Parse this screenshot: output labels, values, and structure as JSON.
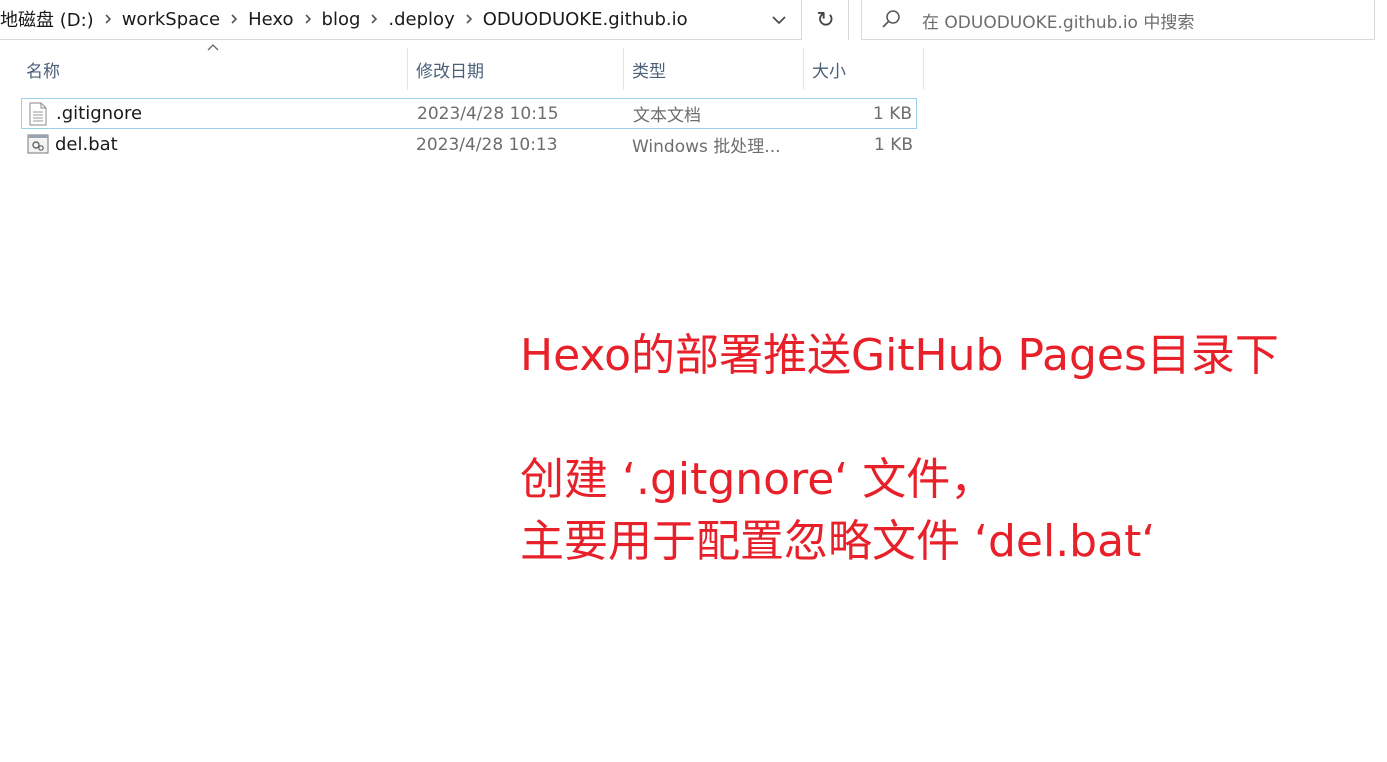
{
  "address_bar": {
    "crumbs": [
      "地磁盘 (D:)",
      "workSpace",
      "Hexo",
      "blog",
      ".deploy",
      "ODUODUOKE.github.io"
    ]
  },
  "search": {
    "placeholder": "在 ODUODUOKE.github.io 中搜索"
  },
  "columns": {
    "name": "名称",
    "date": "修改日期",
    "type": "类型",
    "size": "大小"
  },
  "files": [
    {
      "name": ".gitignore",
      "date": "2023/4/28 10:15",
      "type": "文本文档",
      "size": "1 KB",
      "icon": "text-file-icon",
      "selected": true
    },
    {
      "name": "del.bat",
      "date": "2023/4/28 10:13",
      "type": "Windows 批处理...",
      "size": "1 KB",
      "icon": "batch-file-icon",
      "selected": false
    }
  ],
  "annotation": {
    "line1": "Hexo的部署推送GitHub Pages目录下",
    "line2": "创建 ‘.gitgnore‘ 文件，",
    "line3": "主要用于配置忽略文件 ‘del.bat‘"
  },
  "colors": {
    "annotation": "#e8202a",
    "selection_border": "#99d1ea",
    "header_text": "#4c607a"
  }
}
